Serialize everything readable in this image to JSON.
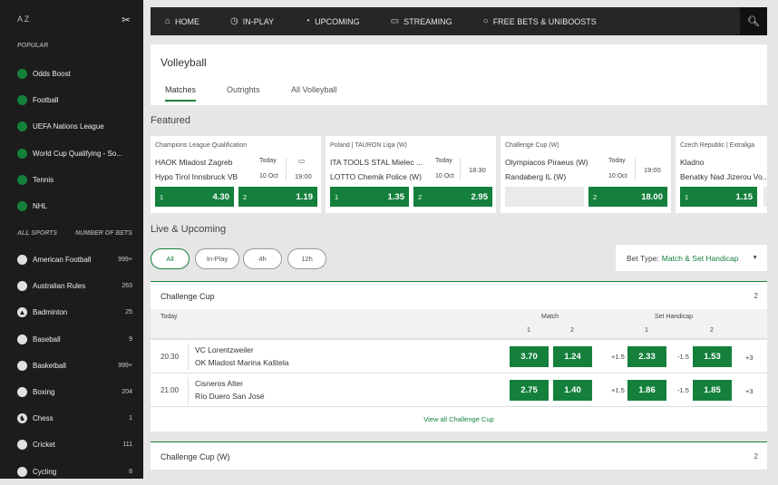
{
  "sidebar": {
    "az": "A Z",
    "popular_label": "Popular",
    "popular": [
      {
        "label": "Odds Boost",
        "icon": "odds-boost-icon"
      },
      {
        "label": "Football",
        "icon": "football-icon"
      },
      {
        "label": "UEFA Nations League",
        "icon": "football-icon"
      },
      {
        "label": "World Cup Qualifying - So...",
        "icon": "football-icon"
      },
      {
        "label": "Tennis",
        "icon": "tennis-icon"
      },
      {
        "label": "NHL",
        "icon": "hockey-icon"
      }
    ],
    "all_sports_label": "All Sports",
    "number_of_bets_label": "Number of Bets",
    "sports": [
      {
        "label": "American Football",
        "count": "999+",
        "icon": "american-football-icon"
      },
      {
        "label": "Australian Rules",
        "count": "263",
        "icon": "aussie-rules-icon"
      },
      {
        "label": "Badminton",
        "count": "25",
        "icon": "badminton-icon"
      },
      {
        "label": "Baseball",
        "count": "9",
        "icon": "baseball-icon"
      },
      {
        "label": "Basketball",
        "count": "999+",
        "icon": "basketball-icon"
      },
      {
        "label": "Boxing",
        "count": "204",
        "icon": "boxing-icon"
      },
      {
        "label": "Chess",
        "count": "1",
        "icon": "chess-icon"
      },
      {
        "label": "Cricket",
        "count": "111",
        "icon": "cricket-icon"
      },
      {
        "label": "Cycling",
        "count": "8",
        "icon": "cycling-icon"
      }
    ]
  },
  "nav": {
    "items": [
      {
        "label": "HOME",
        "icon": "home-icon"
      },
      {
        "label": "IN-PLAY",
        "icon": "in-play-icon"
      },
      {
        "label": "UPCOMING",
        "icon": "upcoming-icon"
      },
      {
        "label": "STREAMING",
        "icon": "streaming-icon"
      },
      {
        "label": "FREE BETS & UNIBOOSTS",
        "icon": "free-bets-icon"
      }
    ]
  },
  "page": {
    "title": "Volleyball",
    "tabs": [
      "Matches",
      "Outrights",
      "All Volleyball"
    ],
    "featured_label": "Featured",
    "live_label": "Live & Upcoming"
  },
  "featured": [
    {
      "competition": "Champions League Qualification",
      "team1": "HAOK Mladost Zagreb",
      "team2": "Hypo Tirol Innsbruck VB",
      "date": "Today",
      "day": "10 Oct",
      "time": "19:00",
      "has_stream": true,
      "odds": [
        {
          "sel": "1",
          "price": "4.30"
        },
        {
          "sel": "2",
          "price": "1.19"
        }
      ]
    },
    {
      "competition": "Poland | TAURON Liga (W)",
      "team1": "ITA TOOLS STAL Mielec ...",
      "team2": "LOTTO Chemik Police (W)",
      "date": "Today",
      "day": "10 Oct",
      "time": "18:30",
      "has_stream": false,
      "odds": [
        {
          "sel": "1",
          "price": "1.35"
        },
        {
          "sel": "2",
          "price": "2.95"
        }
      ]
    },
    {
      "competition": "Challenge Cup (W)",
      "team1": "Olympiacos Piraeus (W)",
      "team2": "Randaberg IL (W)",
      "date": "Today",
      "day": "10 Oct",
      "time": "19:00",
      "has_stream": false,
      "odds": [
        {
          "sel": "",
          "price": ""
        },
        {
          "sel": "2",
          "price": "18.00"
        }
      ]
    },
    {
      "competition": "Czech Republic | Extraliga",
      "team1": "Kladno",
      "team2": "Benatky Nad Jizerou Vo...",
      "date": "",
      "day": "",
      "time": "",
      "has_stream": false,
      "odds": [
        {
          "sel": "1",
          "price": "1.15"
        },
        {
          "sel": "",
          "price": ""
        }
      ]
    }
  ],
  "filters": [
    "All",
    "In-Play",
    "4h",
    "12h"
  ],
  "bet_type": {
    "label": "Bet Type:",
    "value": "Match & Set Handicap"
  },
  "group1": {
    "name": "Challenge Cup",
    "count": "2",
    "day_label": "Today",
    "match_label": "Match",
    "handicap_label": "Set Handicap",
    "col1": "1",
    "col2": "2",
    "rows": [
      {
        "time": "20:30",
        "team1": "VC Lorentzweiler",
        "team2": "OK Mladost Marina Kaštela",
        "m1": "3.70",
        "m2": "1.24",
        "h1_line": "+1.5",
        "h1": "2.33",
        "h2_line": "-1.5",
        "h2": "1.53",
        "more": "+3"
      },
      {
        "time": "21:00",
        "team1": "Cisneros Alter",
        "team2": "Río Duero San José",
        "m1": "2.75",
        "m2": "1.40",
        "h1_line": "+1.5",
        "h1": "1.86",
        "h2_line": "-1.5",
        "h2": "1.85",
        "more": "+3"
      }
    ],
    "view_all": "View all Challenge Cup"
  },
  "group2": {
    "name": "Challenge Cup (W)",
    "count": "2"
  },
  "colors": {
    "accent": "#14803c",
    "sidebar": "#1c1c1c",
    "nav": "#262626"
  }
}
